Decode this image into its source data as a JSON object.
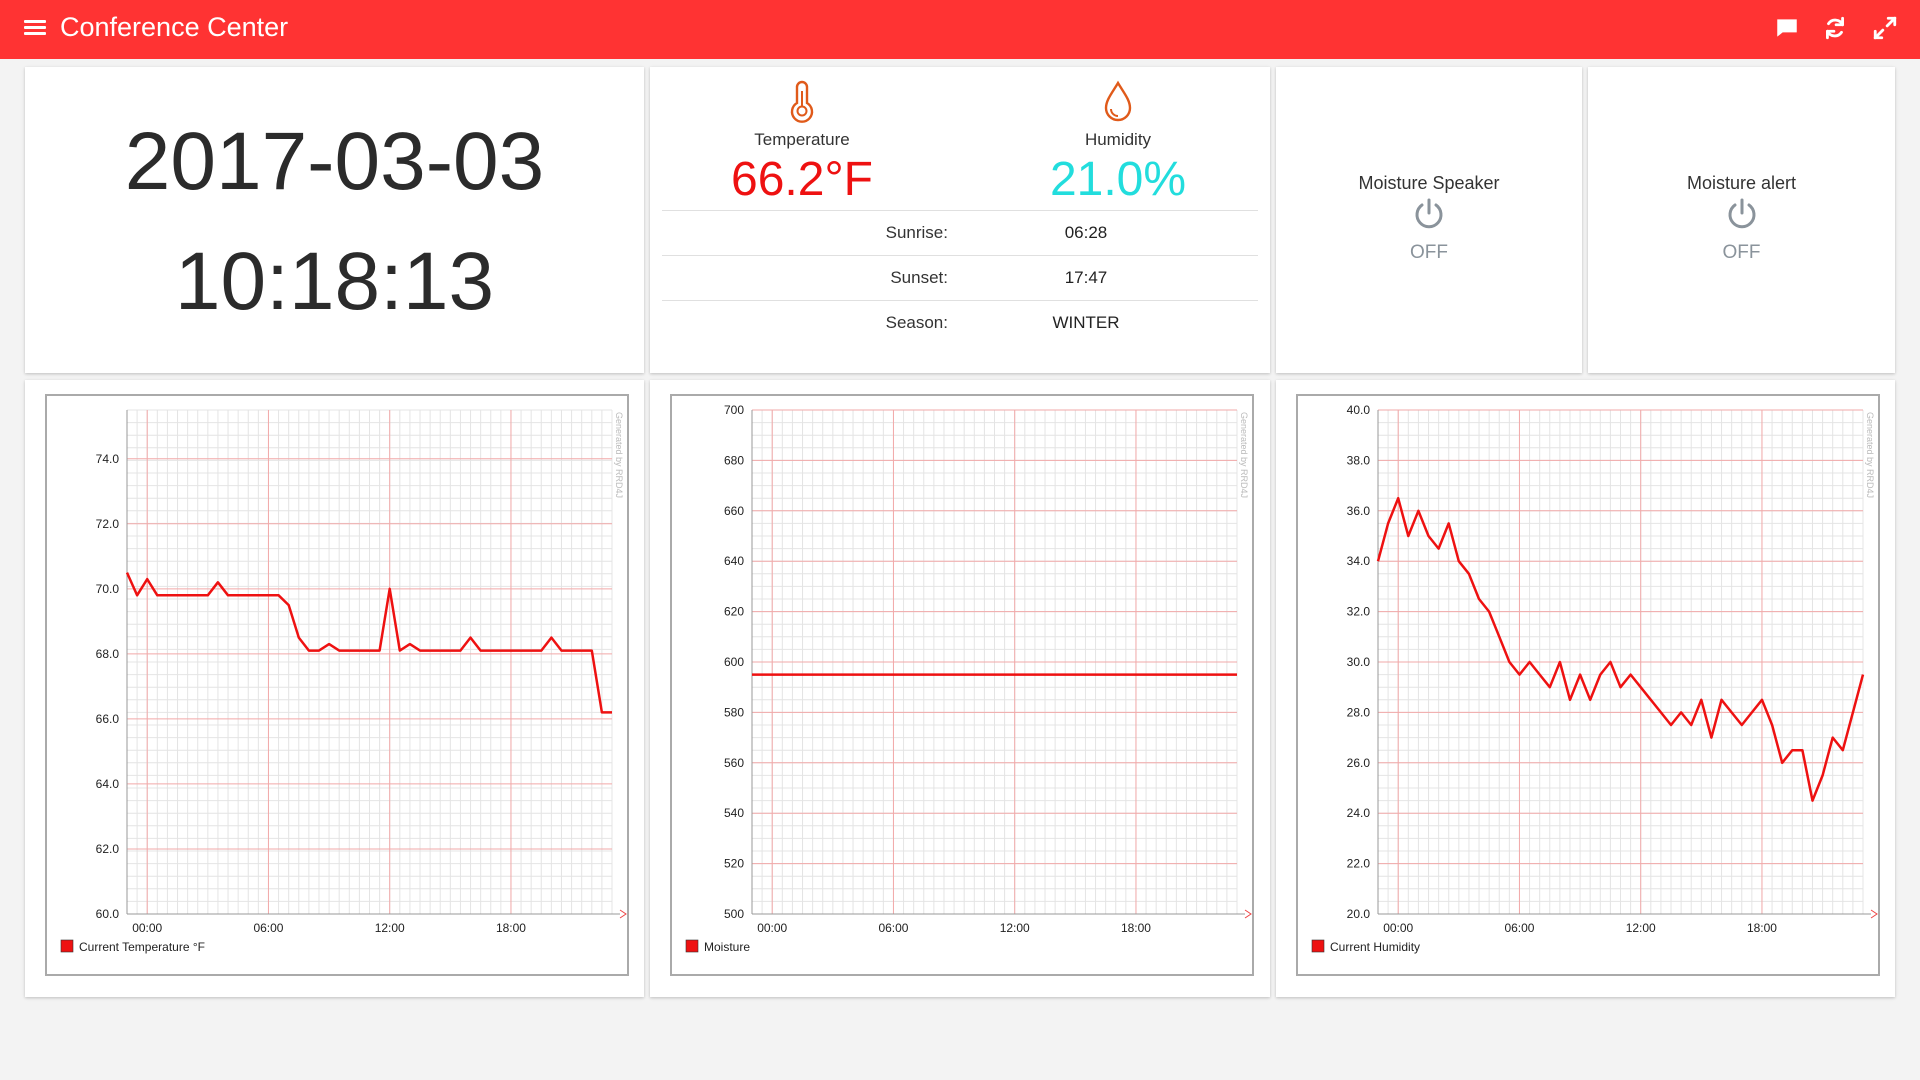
{
  "header": {
    "title": "Conference Center",
    "icons": [
      "menu-icon",
      "chat-icon",
      "refresh-icon",
      "fullscreen-icon"
    ],
    "bg_color": "#ff3333"
  },
  "clock": {
    "date": "2017-03-03",
    "time": "10:18:13"
  },
  "weather": {
    "temperature_label": "Temperature",
    "temperature_value": "66.2°F",
    "temperature_color": "#ee1111",
    "humidity_label": "Humidity",
    "humidity_value": "21.0%",
    "humidity_color": "#22dddd",
    "icon_color": "#e05a1a",
    "rows": [
      {
        "label": "Sunrise:",
        "value": "06:28"
      },
      {
        "label": "Sunset:",
        "value": "17:47"
      },
      {
        "label": "Season:",
        "value": "WINTER"
      }
    ]
  },
  "switches": [
    {
      "label": "Moisture Speaker",
      "state": "OFF",
      "icon": "power-icon"
    },
    {
      "label": "Moisture alert",
      "state": "OFF",
      "icon": "power-icon"
    }
  ],
  "chart_data": [
    {
      "type": "line",
      "legend": "Current Temperature °F",
      "watermark": "Generated by RRD4J",
      "ylim": [
        60,
        75.5
      ],
      "yticks": [
        "60.0",
        "62.0",
        "64.0",
        "66.0",
        "68.0",
        "70.0",
        "72.0",
        "74.0"
      ],
      "xlim": [
        0,
        24
      ],
      "xticks": [
        "00:00",
        "06:00",
        "12:00",
        "18:00"
      ],
      "x": [
        0,
        0.5,
        1,
        1.5,
        2,
        2.5,
        3,
        3.5,
        4,
        4.5,
        5,
        5.5,
        6,
        6.5,
        7,
        7.5,
        8,
        8.5,
        9,
        9.5,
        10,
        10.5,
        11,
        11.5,
        12,
        12.5,
        13,
        13.5,
        14,
        14.5,
        15,
        15.5,
        16,
        16.5,
        17,
        17.5,
        18,
        18.5,
        19,
        19.5,
        20,
        20.5,
        21,
        21.5,
        22,
        22.5,
        23,
        23.5,
        24
      ],
      "y": [
        70.5,
        69.8,
        70.3,
        69.8,
        69.8,
        69.8,
        69.8,
        69.8,
        69.8,
        70.2,
        69.8,
        69.8,
        69.8,
        69.8,
        69.8,
        69.8,
        69.5,
        68.5,
        68.1,
        68.1,
        68.3,
        68.1,
        68.1,
        68.1,
        68.1,
        68.1,
        70.0,
        68.1,
        68.3,
        68.1,
        68.1,
        68.1,
        68.1,
        68.1,
        68.5,
        68.1,
        68.1,
        68.1,
        68.1,
        68.1,
        68.1,
        68.1,
        68.5,
        68.1,
        68.1,
        68.1,
        68.1,
        66.2,
        66.2,
        66.2,
        66.2,
        66.2,
        66.6,
        66.2,
        65.5,
        65.0
      ]
    },
    {
      "type": "line",
      "legend": "Moisture",
      "watermark": "Generated by RRD4J",
      "ylim": [
        500,
        700
      ],
      "yticks": [
        "500",
        "520",
        "540",
        "560",
        "580",
        "600",
        "620",
        "640",
        "660",
        "680",
        "700"
      ],
      "xlim": [
        0,
        24
      ],
      "xticks": [
        "00:00",
        "06:00",
        "12:00",
        "18:00"
      ],
      "x": [
        0,
        24
      ],
      "y": [
        595,
        595
      ]
    },
    {
      "type": "line",
      "legend": "Current Humidity",
      "watermark": "Generated by RRD4J",
      "ylim": [
        20,
        40
      ],
      "yticks": [
        "20.0",
        "22.0",
        "24.0",
        "26.0",
        "28.0",
        "30.0",
        "32.0",
        "34.0",
        "36.0",
        "38.0",
        "40.0"
      ],
      "xlim": [
        0,
        24
      ],
      "xticks": [
        "00:00",
        "06:00",
        "12:00",
        "18:00"
      ],
      "x": [
        0,
        0.5,
        1,
        1.5,
        2,
        2.5,
        3,
        3.5,
        4,
        4.5,
        5,
        5.5,
        6,
        6.5,
        7,
        7.5,
        8,
        8.5,
        9,
        9.5,
        10,
        10.5,
        11,
        11.5,
        12,
        12.5,
        13,
        13.5,
        14,
        14.5,
        15,
        15.5,
        16,
        16.5,
        17,
        17.5,
        18,
        18.5,
        19,
        19.5,
        20,
        20.5,
        21,
        21.5,
        22,
        22.5,
        23,
        23.5,
        24
      ],
      "y": [
        34,
        35.5,
        36.5,
        35,
        36,
        35,
        34.5,
        35.5,
        34,
        33.5,
        32.5,
        32,
        31,
        30,
        29.5,
        30,
        29.5,
        29,
        30,
        28.5,
        29.5,
        28.5,
        29.5,
        30,
        29,
        29.5,
        29,
        28.5,
        28,
        27.5,
        28,
        27.5,
        28.5,
        27,
        28.5,
        28,
        27.5,
        28,
        28.5,
        27.5,
        26,
        26.5,
        26.5,
        24.5,
        25.5,
        27,
        26.5,
        28,
        29.5
      ]
    }
  ]
}
